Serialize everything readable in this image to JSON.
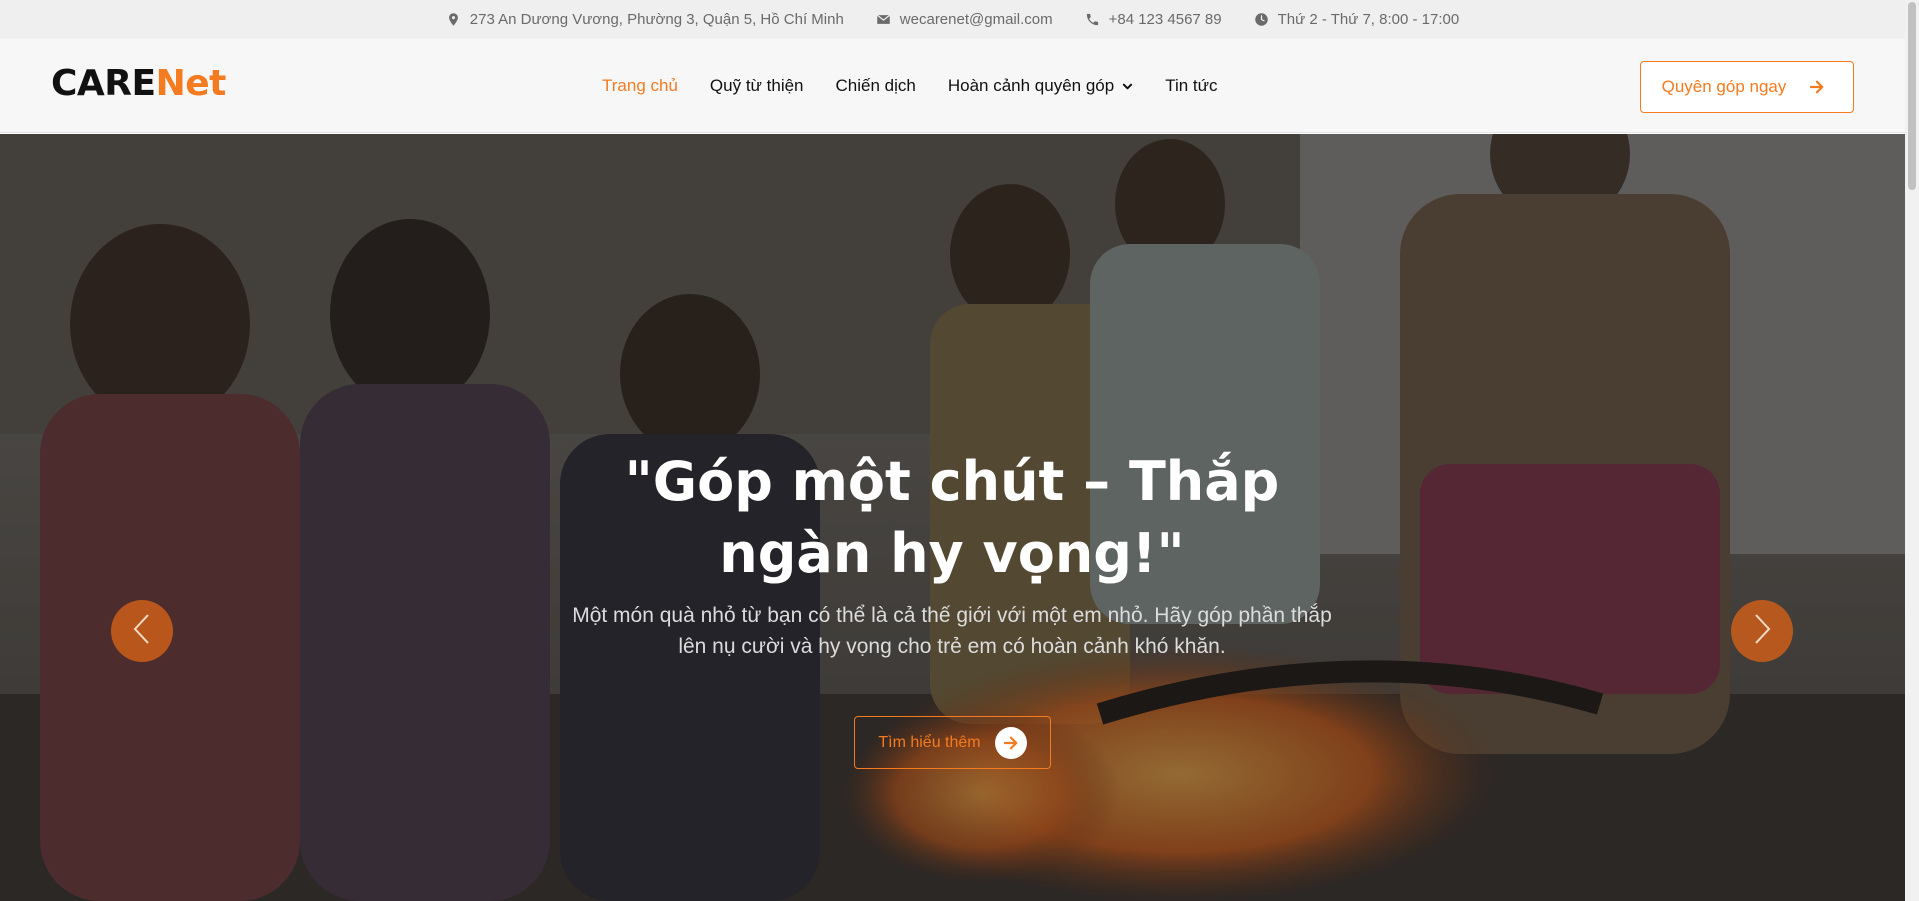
{
  "topbar": {
    "address": "273 An Dương Vương, Phường 3, Quận 5, Hồ Chí Minh",
    "email": "wecarenet@gmail.com",
    "phone": "+84 123 4567 89",
    "hours": "Thứ 2 - Thứ 7, 8:00 - 17:00",
    "icons": [
      "map-pin-icon",
      "envelope-icon",
      "phone-icon",
      "clock-icon"
    ]
  },
  "header": {
    "logo_primary": "CARE",
    "logo_accent": "Net",
    "nav": [
      {
        "label": "Trang chủ",
        "active": true
      },
      {
        "label": "Quỹ từ thiện"
      },
      {
        "label": "Chiến dịch"
      },
      {
        "label": "Hoàn cảnh quyên góp",
        "dropdown": true
      },
      {
        "label": "Tin tức"
      }
    ],
    "cta_label": "Quyên góp ngay"
  },
  "hero": {
    "title": "\"Góp một chút – Thắp ngàn hy vọng!\"",
    "subtitle": "Một món quà nhỏ từ bạn có thể là cả thế giới với một em nhỏ. Hãy góp phần thắp lên nụ cười và hy vọng cho trẻ em có hoàn cảnh khó khăn.",
    "button_label": "Tìm hiểu thêm"
  },
  "colors": {
    "accent": "#f47b20",
    "topbar_bg": "#efefef",
    "header_bg": "#f7f7f7"
  }
}
